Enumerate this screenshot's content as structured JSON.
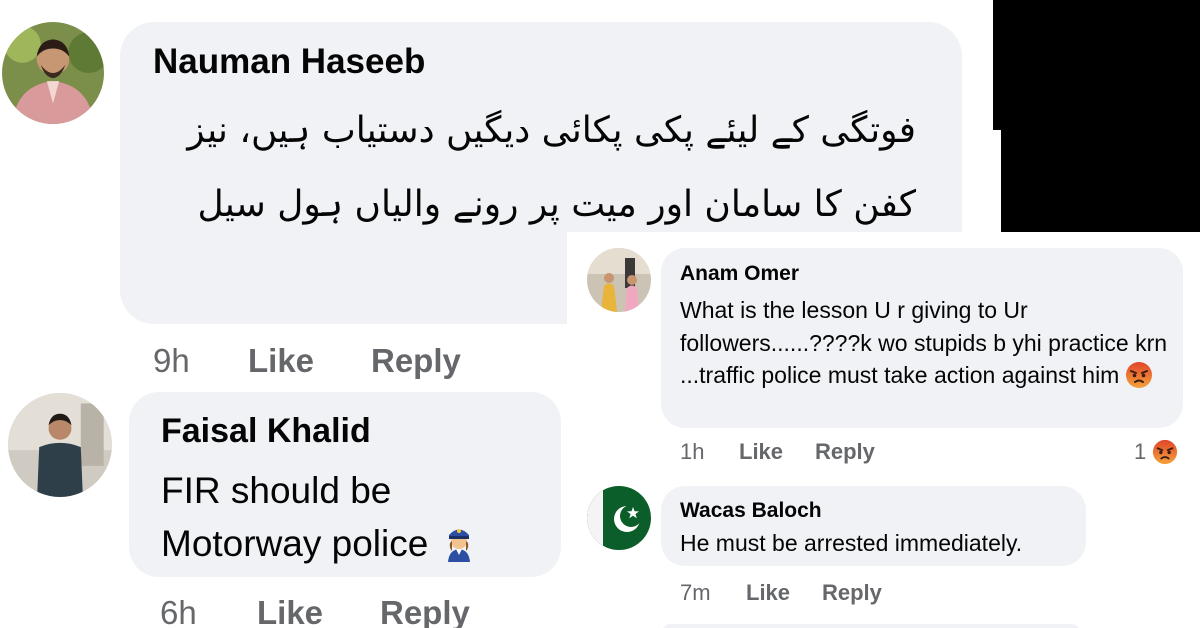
{
  "comments": [
    {
      "author": "Nauman Haseeb",
      "text": "فوتگی کے لیئے پکی پکائی دیگیں دستیاب ہیں، نیز کفن کا سامان اور میت پر رونے والیاں ہول سیل میں دستیاب ہیں،",
      "time": "9h",
      "like_label": "Like",
      "reply_label": "Reply"
    },
    {
      "author": "Faisal Khalid",
      "text_line1": "FIR should be",
      "text_line2": "Motorway police",
      "emoji": "police-officer-woman-emoji",
      "time": "6h",
      "like_label": "Like",
      "reply_label": "Reply"
    },
    {
      "author": "Anam Omer",
      "text": "What is the lesson U r giving to Ur followers......????k wo stupids b yhi practice krn ...traffic police must take action against him",
      "emoji": "angry-face-emoji",
      "time": "1h",
      "like_label": "Like",
      "reply_label": "Reply",
      "reaction_count": "1",
      "reaction_icon": "angry-reaction-icon"
    },
    {
      "author": "Wacas Baloch",
      "text": "He must be arrested immediately.",
      "time": "7m",
      "like_label": "Like",
      "reply_label": "Reply"
    }
  ],
  "colors": {
    "bubble": "#f0f2f5",
    "meta_text": "#65676b",
    "text": "#050505",
    "angry": "#f0682c"
  }
}
